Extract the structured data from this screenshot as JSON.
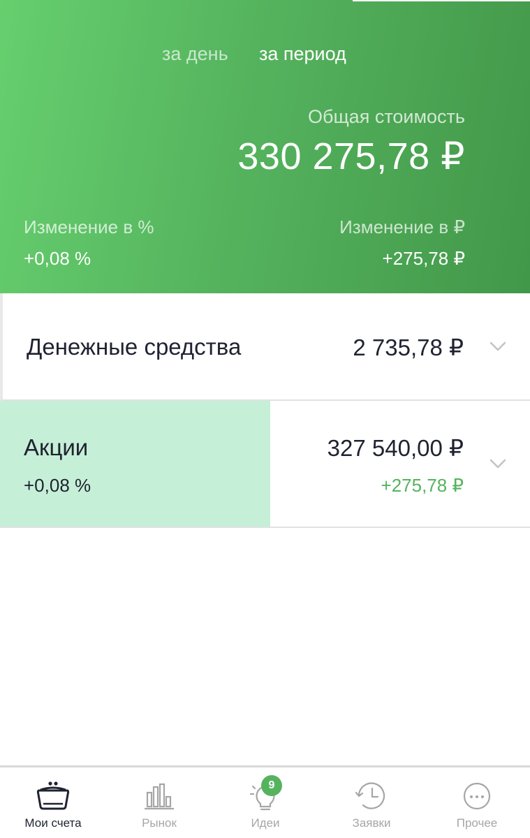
{
  "period_tabs": {
    "day": "за день",
    "period": "за период",
    "selected": "за период"
  },
  "summary": {
    "total_label": "Общая стоимость",
    "total_value": "330 275,78 ₽",
    "change_pct_label": "Изменение в  %",
    "change_pct_value": "+0,08  %",
    "change_rub_label": "Изменение в ₽",
    "change_rub_value": "+275,78 ₽"
  },
  "rows": [
    {
      "title": "Денежные средства",
      "amount": "2 735,78 ₽"
    },
    {
      "title": "Акции",
      "amount": "327 540,00 ₽",
      "change_pct": "+0,08  %",
      "change_rub": "+275,78 ₽"
    }
  ],
  "nav": {
    "items": [
      {
        "label": "Мои счета",
        "icon": "wallet-icon",
        "active": true
      },
      {
        "label": "Рынок",
        "icon": "market-chart-icon",
        "active": false
      },
      {
        "label": "Идеи",
        "icon": "lightbulb-icon",
        "active": false,
        "badge": "9"
      },
      {
        "label": "Заявки",
        "icon": "history-clock-icon",
        "active": false
      },
      {
        "label": "Прочее",
        "icon": "more-dots-icon",
        "active": false
      }
    ]
  },
  "colors": {
    "header_gradient_start": "#66cf6e",
    "header_gradient_end": "#429849",
    "positive_green": "#55b35e",
    "stocks_highlight": "#c6efd8",
    "text_dark": "#1f2330",
    "nav_inactive": "#a6a6a6"
  }
}
